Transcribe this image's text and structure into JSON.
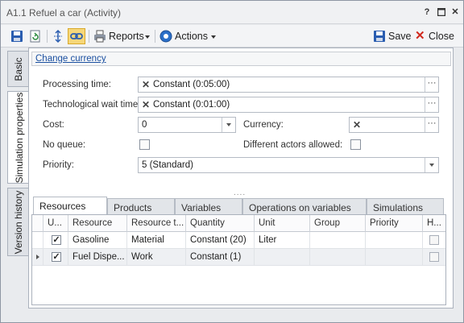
{
  "window": {
    "title": "A1.1 Refuel a car (Activity)",
    "help": "?",
    "restore": "◘",
    "close": "✕"
  },
  "toolbar": {
    "reports_label": "Reports",
    "actions_label": "Actions",
    "save_label": "Save",
    "close_label": "Close"
  },
  "side_tabs": [
    "Basic",
    "Simulation properties",
    "Version history"
  ],
  "change_currency": "Change currency",
  "form": {
    "processing_time_label": "Processing time:",
    "processing_time_value": "Constant (0:05:00)",
    "wait_time_label": "Technological wait time:",
    "wait_time_value": "Constant (0:01:00)",
    "cost_label": "Cost:",
    "cost_value": "0",
    "currency_label": "Currency:",
    "currency_value": "",
    "no_queue_label": "No queue:",
    "different_actors_label": "Different actors allowed:",
    "priority_label": "Priority:",
    "priority_value": "5 (Standard)",
    "splitter": "...."
  },
  "tabs": [
    "Resources",
    "Products",
    "Variables",
    "Operations on variables",
    "Simulations"
  ],
  "grid": {
    "headers": [
      "U...",
      "Resource",
      "Resource t...",
      "Quantity",
      "Unit",
      "Group",
      "Priority",
      "H..."
    ],
    "rows": [
      {
        "used": true,
        "resource": "Gasoline",
        "type": "Material",
        "quantity": "Constant (20)",
        "unit": "Liter",
        "group": "",
        "priority": "",
        "h": false
      },
      {
        "used": true,
        "resource": "Fuel Dispe...",
        "type": "Work",
        "quantity": "Constant (1)",
        "unit": "",
        "group": "",
        "priority": "",
        "h": false
      }
    ]
  }
}
